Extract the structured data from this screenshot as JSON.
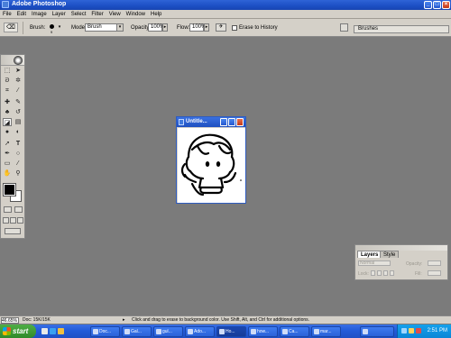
{
  "window": {
    "title": "Adobe Photoshop"
  },
  "menu": [
    "File",
    "Edit",
    "Image",
    "Layer",
    "Select",
    "Filter",
    "View",
    "Window",
    "Help"
  ],
  "options": {
    "brush_label": "Brush:",
    "brush_size": "9",
    "mode_label": "Mode:",
    "mode_value": "Brush",
    "opacity_label": "Opacity:",
    "opacity_value": "100%",
    "flow_label": "Flow:",
    "flow_value": "100%",
    "erase_history_label": "Erase to History",
    "brushes_tab": "Brushes"
  },
  "document": {
    "title": "Untitle..."
  },
  "layers": {
    "tabs": [
      "Layers",
      "Style"
    ],
    "mode_value": "Normal",
    "opacity_label": "Opacity:",
    "lock_label": "Lock:",
    "fill_label": "Fill:"
  },
  "status": {
    "zoom": "46.65%",
    "doc": "Doc: 15K/15K",
    "hint": "Click and drag to erase to background color. Use Shift, Alt, and Ctrl for additional options."
  },
  "taskbar": {
    "start": "start",
    "tasks": [
      "Doc...",
      "Gal...",
      "gul...",
      "Ado...",
      "Ho...",
      "how...",
      "Ca...",
      "mar..."
    ],
    "clock": "2:51 PM"
  },
  "colors": {
    "workspace": "#7b7b7b",
    "titlebar": "#1c4fc4",
    "chrome": "#d4d0c8",
    "taskbar": "#245ddb",
    "start": "#2f8a2a"
  }
}
